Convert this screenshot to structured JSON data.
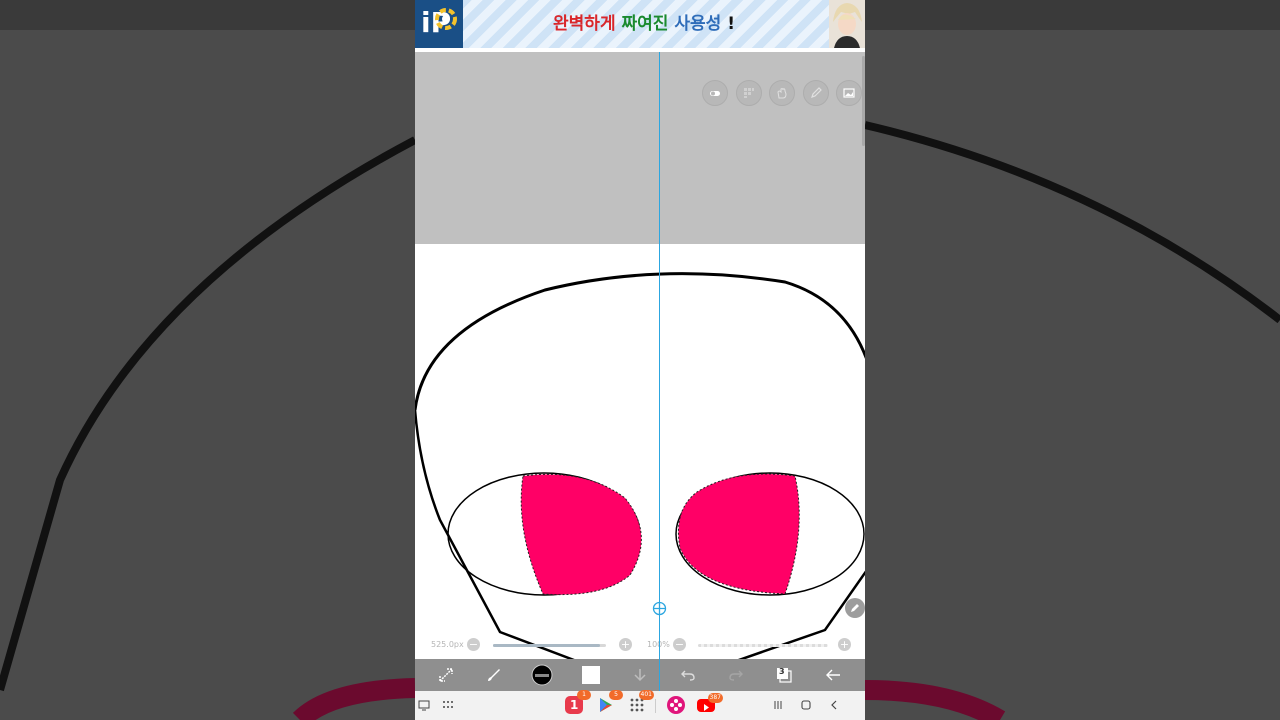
{
  "ad": {
    "logo_text": "iP",
    "headline_1": "완벽하게",
    "headline_2": "짜여진",
    "headline_3": "사용성",
    "headline_4": "!"
  },
  "canvas": {
    "brush_size_label": "525.0px",
    "opacity_label": "100%",
    "brush_size_level": 0.95,
    "opacity_level": 1.0,
    "eye_fill_color": "#ff0066",
    "guide_color": "#2ca6e0",
    "line_color": "#000000"
  },
  "toolbar": {
    "layers_count": "3"
  },
  "navbar": {
    "badges": {
      "app_1": "1",
      "play_store": "5",
      "apps_grid": "401",
      "youtube": "387"
    }
  },
  "icons": [
    "transform-icon",
    "brush-icon",
    "color-swatch-icon",
    "download-icon",
    "undo-icon",
    "redo-icon",
    "layers-icon",
    "back-arrow-icon"
  ]
}
